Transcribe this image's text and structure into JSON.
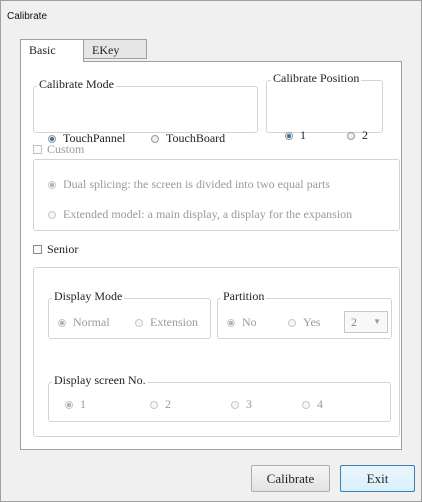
{
  "window": {
    "title": "Calibrate"
  },
  "tabs": [
    {
      "label": "Basic"
    },
    {
      "label": "EKey"
    }
  ],
  "calibrate_mode": {
    "legend": "Calibrate Mode",
    "options": [
      {
        "label": "TouchPannel",
        "selected": true
      },
      {
        "label": "TouchBoard",
        "selected": false
      }
    ]
  },
  "calibrate_position": {
    "legend": "Calibrate Position",
    "options": [
      {
        "label": "1",
        "selected": true
      },
      {
        "label": "2",
        "selected": false
      }
    ]
  },
  "custom": {
    "label": "Custom",
    "options": [
      {
        "label": "Dual splicing: the screen is divided into two equal parts",
        "selected": true
      },
      {
        "label": "Extended model: a main display, a display for the expansion",
        "selected": false
      }
    ]
  },
  "senior": {
    "label": "Senior",
    "display_mode": {
      "legend": "Display Mode",
      "options": [
        {
          "label": "Normal",
          "selected": true
        },
        {
          "label": "Extension",
          "selected": false
        }
      ]
    },
    "partition": {
      "legend": "Partition",
      "options": [
        {
          "label": "No",
          "selected": true
        },
        {
          "label": "Yes",
          "selected": false
        }
      ],
      "count_value": "2"
    },
    "display_screen": {
      "legend": "Display screen No.",
      "options": [
        {
          "label": "1",
          "selected": true
        },
        {
          "label": "2",
          "selected": false
        },
        {
          "label": "3",
          "selected": false
        },
        {
          "label": "4",
          "selected": false
        }
      ]
    }
  },
  "buttons": {
    "calibrate": "Calibrate",
    "exit": "Exit"
  }
}
